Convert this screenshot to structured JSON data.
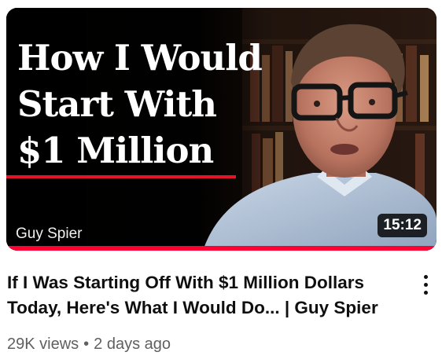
{
  "thumbnail": {
    "title_lines": [
      "How I Would",
      "Start With",
      "$1 Million"
    ],
    "channel_watermark": "Guy Spier",
    "duration": "15:12",
    "watched_fraction": 1.0,
    "accent_color": "#e3132a",
    "progress_color": "#ff0033"
  },
  "video": {
    "title_lines": [
      "If I Was Starting Off With $1 Million Dollars",
      "Today, Here's What I Would Do... | Guy Spier"
    ],
    "views": "29K views",
    "separator": "•",
    "age": "2 days ago"
  },
  "menu": {
    "icon": "more-vert-icon"
  }
}
